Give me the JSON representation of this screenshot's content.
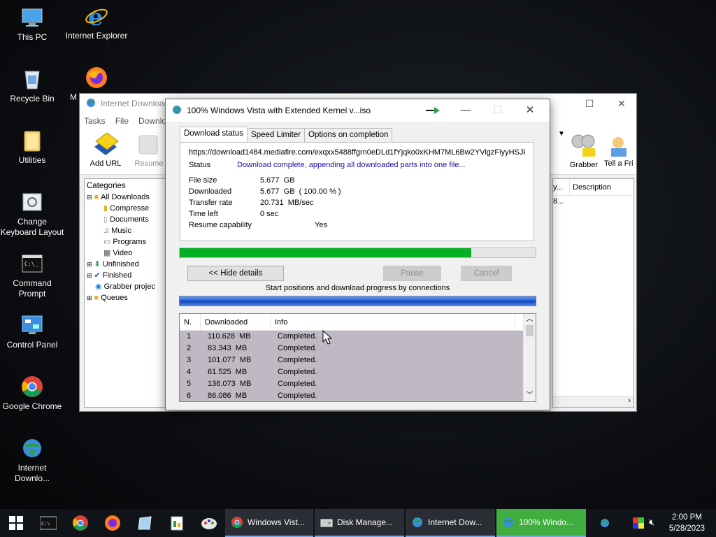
{
  "desktop": {
    "icons": [
      {
        "label": "This PC"
      },
      {
        "label": "Internet Explorer"
      },
      {
        "label": "Recycle Bin"
      },
      {
        "label": "M"
      },
      {
        "label": "Utilities"
      },
      {
        "label": "Change Keyboard Layout"
      },
      {
        "label": "Command Prompt"
      },
      {
        "label": "Control Panel"
      },
      {
        "label": "Google Chrome"
      },
      {
        "label": "Internet Downlo..."
      }
    ]
  },
  "idm_main": {
    "title": "Internet Download",
    "menu": [
      "Tasks",
      "File",
      "Downlo"
    ],
    "toolbar": {
      "add_url": "Add URL",
      "resume": "Resume",
      "grabber": "Grabber",
      "tell": "Tell a Fri"
    },
    "categories_label": "Categories",
    "categories": [
      "All Downloads",
      "Compresse",
      "Documents",
      "Music",
      "Programs",
      "Video",
      "Unfinished",
      "Finished",
      "Grabber projec",
      "Queues"
    ],
    "list_header_1": "y...",
    "list_header_2": "Description",
    "list_cell": "8..."
  },
  "dialog": {
    "title": "100% Windows Vista with Extended Kernel v...iso",
    "tabs": [
      "Download status",
      "Speed Limiter",
      "Options on completion"
    ],
    "url": "https://download1484.mediafire.com/exqxx5488ffgrn0eDLd1fYjqko0xKHM7ML6Bw2YVigzFiyyHSJkY8",
    "status_label": "Status",
    "status_value": "Download complete, appending all downloaded parts into one file...",
    "file_size_label": "File size",
    "file_size_value": "5.677  GB",
    "downloaded_label": "Downloaded",
    "downloaded_value": "5.677  GB  ( 100.00 % )",
    "transfer_label": "Transfer rate",
    "transfer_value": "20.731  MB/sec",
    "time_left_label": "Time left",
    "time_left_value": "0 sec",
    "resume_label": "Resume capability",
    "resume_value": "Yes",
    "progress_fraction": 0.82,
    "hide_details": "<< Hide details",
    "pause": "Pause",
    "cancel": "Cancel",
    "connections_label": "Start positions and download progress by connections",
    "table_headers": [
      "N.",
      "Downloaded",
      "Info"
    ],
    "rows": [
      {
        "n": "1",
        "downloaded": "110.628  MB",
        "info": "Completed."
      },
      {
        "n": "2",
        "downloaded": "83.343  MB",
        "info": "Completed."
      },
      {
        "n": "3",
        "downloaded": "101.077  MB",
        "info": "Completed."
      },
      {
        "n": "4",
        "downloaded": "61.525  MB",
        "info": "Completed."
      },
      {
        "n": "5",
        "downloaded": "136.073  MB",
        "info": "Completed."
      },
      {
        "n": "6",
        "downloaded": "86.086  MB",
        "info": "Completed."
      }
    ]
  },
  "taskbar": {
    "tasks": [
      {
        "label": "Windows Vist..."
      },
      {
        "label": "Disk Manage..."
      },
      {
        "label": "Internet Dow..."
      },
      {
        "label": "100% Windo..."
      }
    ],
    "time": "2:00 PM",
    "date": "5/28/2023"
  },
  "colors": {
    "progress_fill": "#06b025",
    "status_text": "#1a0dab",
    "active_task": "#3fae3f"
  }
}
